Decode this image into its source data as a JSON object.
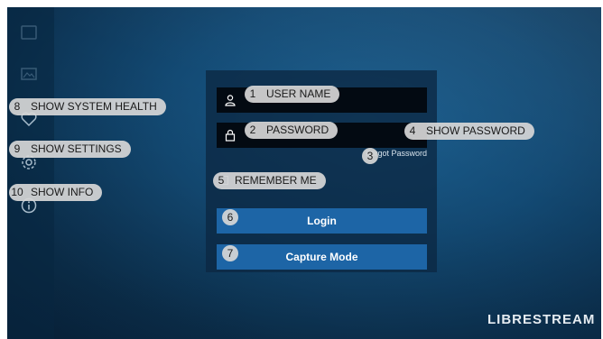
{
  "login": {
    "username_placeholder": "",
    "password_placeholder": "",
    "forgot_password": "Forgot Password",
    "remember_me": "Remember me",
    "login_label": "Login",
    "capture_label": "Capture Mode"
  },
  "branding": {
    "logo_bold": "LIBRESTREAM"
  },
  "annotations": {
    "a1": {
      "num": "1",
      "label": "USER NAME"
    },
    "a2": {
      "num": "2",
      "label": "PASSWORD"
    },
    "a3": {
      "num": "3"
    },
    "a4": {
      "num": "4",
      "label": "SHOW PASSWORD"
    },
    "a5": {
      "num": "5",
      "label": "REMEMBER ME"
    },
    "a6": {
      "num": "6"
    },
    "a7": {
      "num": "7"
    },
    "a8": {
      "num": "8",
      "label": "SHOW SYSTEM HEALTH"
    },
    "a9": {
      "num": "9",
      "label": "SHOW SETTINGS"
    },
    "a10": {
      "num": "10",
      "label": "SHOW INFO"
    }
  },
  "icons": {
    "sidebar": [
      "stream-icon",
      "gallery-icon",
      "heart-icon",
      "gear-icon",
      "info-icon"
    ],
    "fields": [
      "user-icon",
      "lock-icon"
    ]
  },
  "colors": {
    "background": "#134a74",
    "panel": "#0c2842",
    "field": "#030a12",
    "button": "#1d65a6"
  }
}
